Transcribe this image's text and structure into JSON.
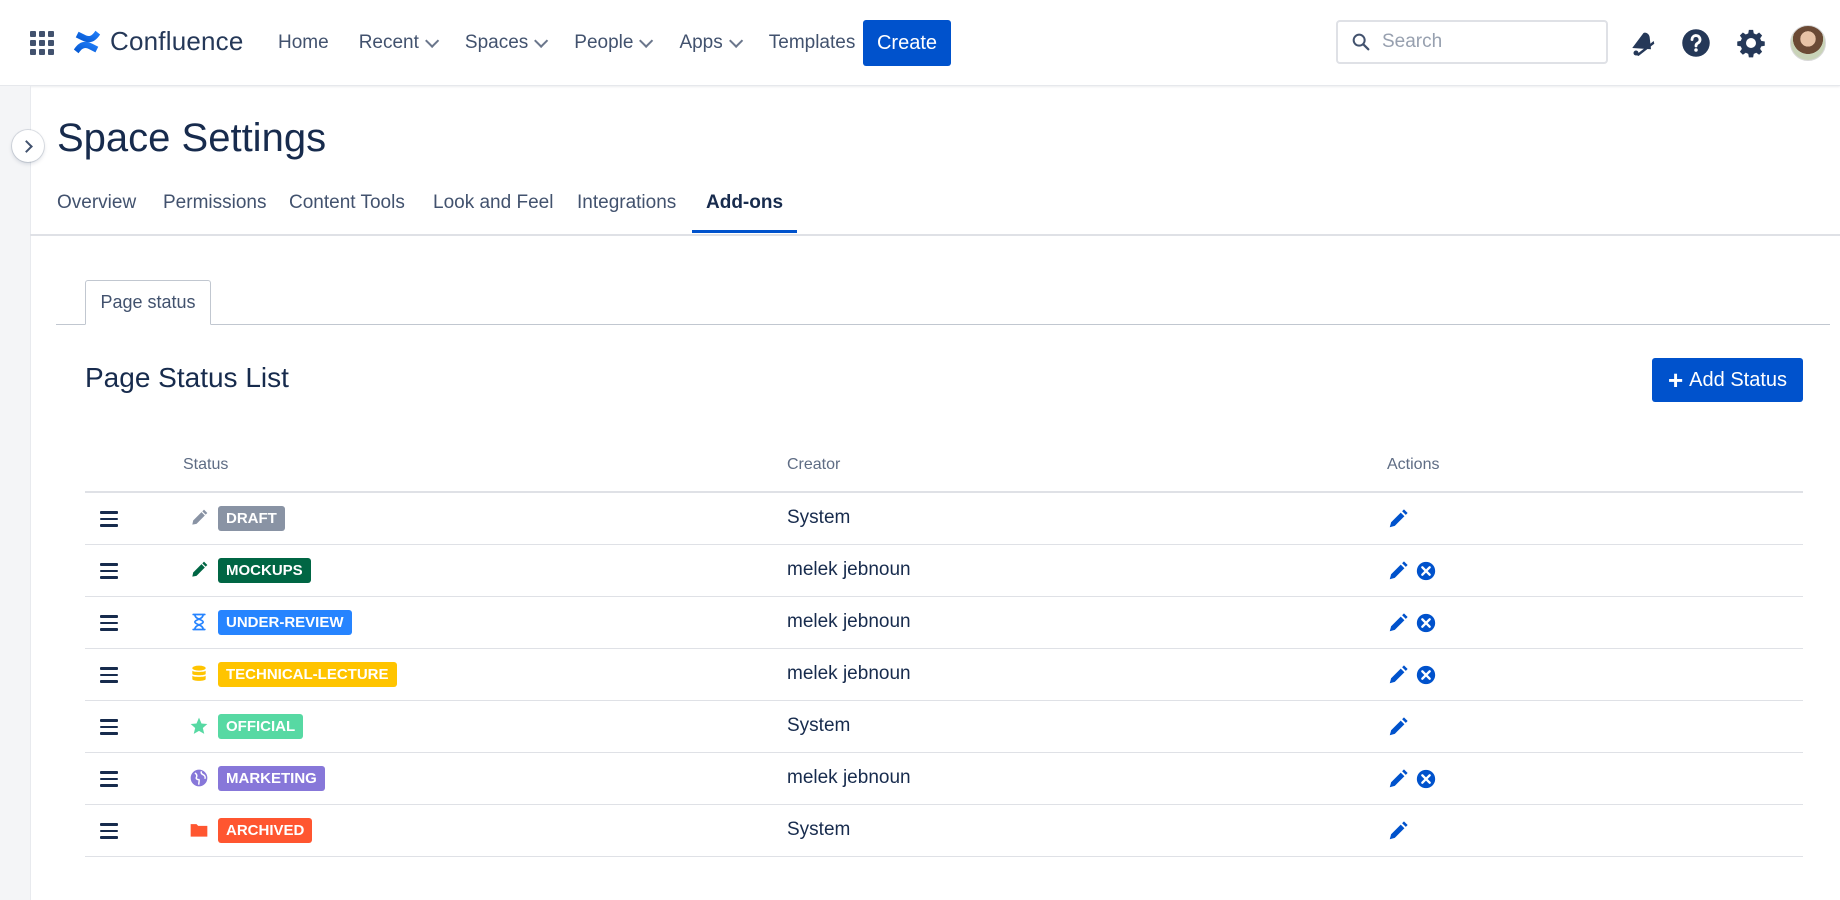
{
  "app": {
    "name": "Confluence"
  },
  "nav": {
    "items": [
      {
        "label": "Home",
        "dropdown": false
      },
      {
        "label": "Recent",
        "dropdown": true
      },
      {
        "label": "Spaces",
        "dropdown": true
      },
      {
        "label": "People",
        "dropdown": true
      },
      {
        "label": "Apps",
        "dropdown": true
      },
      {
        "label": "Templates",
        "dropdown": false
      }
    ],
    "create_label": "Create",
    "search_placeholder": "Search"
  },
  "page": {
    "title": "Space Settings",
    "tabs": [
      {
        "label": "Overview",
        "active": false
      },
      {
        "label": "Permissions",
        "active": false
      },
      {
        "label": "Content Tools",
        "active": false
      },
      {
        "label": "Look and Feel",
        "active": false
      },
      {
        "label": "Integrations",
        "active": false
      },
      {
        "label": "Add-ons",
        "active": true
      }
    ],
    "subtab": "Page status"
  },
  "status_list": {
    "title": "Page Status List",
    "add_label": "Add Status",
    "columns": [
      "Status",
      "Creator",
      "Actions"
    ],
    "rows": [
      {
        "name": "DRAFT",
        "icon": "pencil-icon",
        "color": "#8993A4",
        "icon_color": "#8993A4",
        "creator": "System",
        "deletable": false
      },
      {
        "name": "MOCKUPS",
        "icon": "pencil-icon",
        "color": "#006644",
        "icon_color": "#006644",
        "creator": "melek jebnoun",
        "deletable": true
      },
      {
        "name": "UNDER-REVIEW",
        "icon": "hourglass-icon",
        "color": "#2684FF",
        "icon_color": "#2684FF",
        "creator": "melek jebnoun",
        "deletable": true
      },
      {
        "name": "TECHNICAL-LECTURE",
        "icon": "database-icon",
        "color": "#FFC400",
        "icon_color": "#FFC400",
        "creator": "melek jebnoun",
        "deletable": true
      },
      {
        "name": "OFFICIAL",
        "icon": "star-icon",
        "color": "#57D9A3",
        "icon_color": "#57D9A3",
        "creator": "System",
        "deletable": false
      },
      {
        "name": "MARKETING",
        "icon": "globe-icon",
        "color": "#8777D9",
        "icon_color": "#8777D9",
        "creator": "melek jebnoun",
        "deletable": true
      },
      {
        "name": "ARCHIVED",
        "icon": "folder-icon",
        "color": "#FF5630",
        "icon_color": "#FF5630",
        "creator": "System",
        "deletable": false
      }
    ]
  },
  "colors": {
    "primary": "#0052CC",
    "text": "#172B4D",
    "subtle": "#42526E",
    "border": "#DFE1E6"
  }
}
